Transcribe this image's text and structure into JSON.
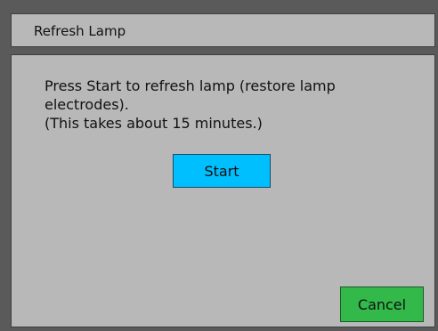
{
  "window": {
    "title": "Refresh Lamp"
  },
  "message": {
    "lines": [
      "Press Start to refresh lamp (restore lamp",
      "electrodes).",
      "(This takes about 15 minutes.)"
    ]
  },
  "buttons": {
    "start_label": "Start",
    "cancel_label": "Cancel"
  },
  "colors": {
    "background": "#5a5a5a",
    "panel": "#b8b8b8",
    "start_button": "#00bfff",
    "cancel_button": "#33b84a"
  }
}
